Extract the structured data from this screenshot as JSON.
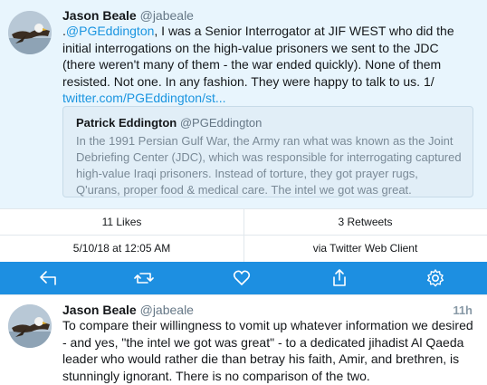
{
  "main_tweet": {
    "name": "Jason Beale",
    "handle": "@jabeale",
    "mention": "@PGEddington",
    "text_prefix": ".",
    "text_body": ", I was a Senior Interrogator at JIF WEST who did the initial interrogations on the high-value prisoners we sent to the JDC (there weren't many of them - the war ended quickly). None of them resisted. Not one. In any fashion. They were happy to talk to us. 1/ ",
    "link": "twitter.com/PGEddington/st..."
  },
  "quoted_tweet": {
    "name": "Patrick Eddington",
    "handle": "@PGEddington",
    "text": "In the 1991 Persian Gulf War, the Army ran what was known as the Joint Debriefing Center (JDC), which was responsible for interrogating captured high-value Iraqi prisoners. Instead of torture, they got prayer rugs, Q'urans, proper food & medical care. The intel we got was great."
  },
  "stats": {
    "likes": "11 Likes",
    "retweets": "3 Retweets",
    "date": "5/10/18 at 12:05 AM",
    "client": "via Twitter Web Client"
  },
  "actions": {
    "icons": [
      "reply-icon",
      "retweet-icon",
      "like-icon",
      "share-icon",
      "settings-icon"
    ],
    "bar_color": "#1d8fe1"
  },
  "reply_tweet": {
    "name": "Jason Beale",
    "handle": "@jabeale",
    "time": "11h",
    "text": "To compare their willingness to vomit up whatever information we desired - and yes, \"the intel we got was great\" - to a dedicated jihadist Al Qaeda leader who would rather die than betray his faith, Amir, and brethren, is stunningly ignorant. There is no comparison of the two."
  },
  "colors": {
    "link": "#1b95e0",
    "main_bg": "#e8f5fd"
  }
}
